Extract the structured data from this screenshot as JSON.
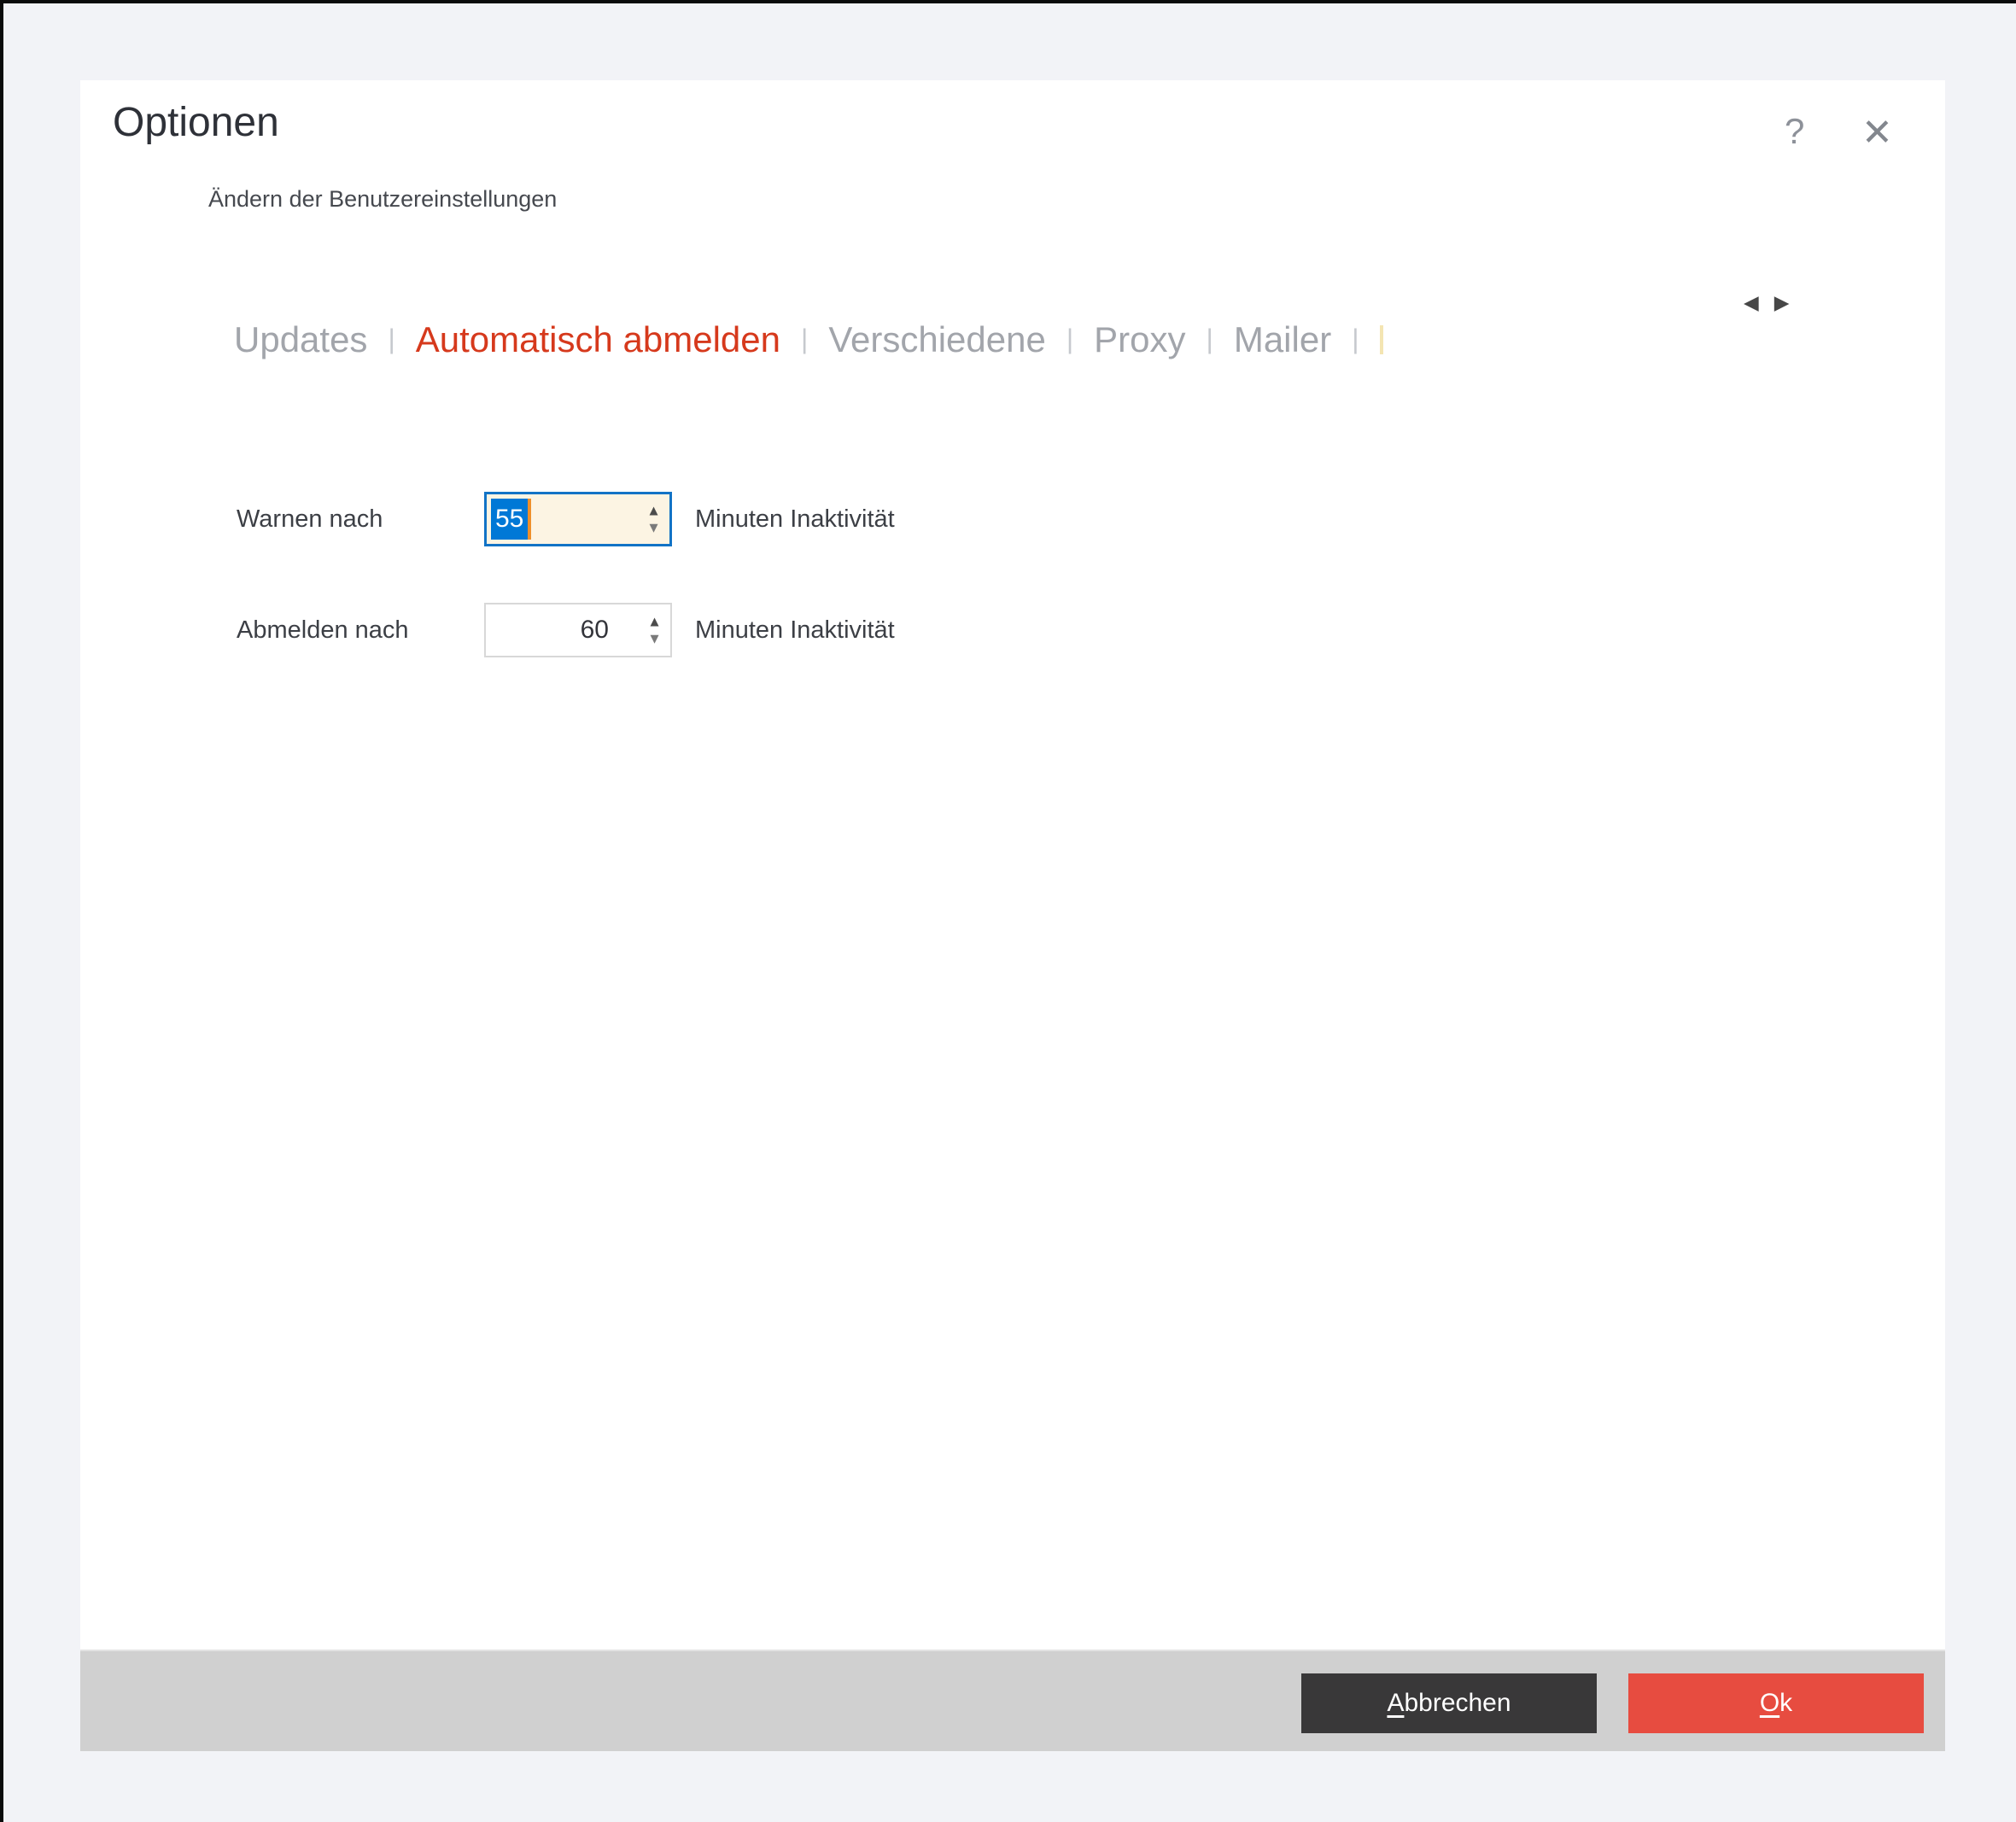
{
  "window": {
    "title": "Optionen",
    "subtitle": "Ändern der Benutzereinstellungen"
  },
  "icons": {
    "help": "?",
    "close": "✕",
    "scroll_left": "◀",
    "scroll_right": "▶",
    "spin_up": "▲",
    "spin_down": "▼"
  },
  "tabs": {
    "separator": "|",
    "items": [
      {
        "label": "Updates",
        "active": false
      },
      {
        "label": "Automatisch abmelden",
        "active": true
      },
      {
        "label": "Verschiedene",
        "active": false
      },
      {
        "label": "Proxy",
        "active": false
      },
      {
        "label": "Mailer",
        "active": false
      }
    ]
  },
  "form": {
    "rows": [
      {
        "label": "Warnen nach",
        "value": "55",
        "suffix": "Minuten Inaktivität",
        "state": "focused, text selected"
      },
      {
        "label": "Abmelden nach",
        "value": "60",
        "suffix": "Minuten Inaktivität",
        "state": "normal"
      }
    ]
  },
  "footer": {
    "cancel": {
      "accesskey": "A",
      "rest": "bbrechen",
      "label": "Abbrechen"
    },
    "ok": {
      "accesskey": "O",
      "rest": "k",
      "label": "Ok"
    }
  },
  "colors": {
    "active_tab_red": "#d6391c",
    "inactive_tab_gray": "#a2a5ab",
    "focus_border_blue": "#1273c6",
    "field_cream": "#fcf4e3",
    "selection_blue": "#0078d6",
    "caret_orange": "#ee8f2a",
    "footer_gray": "#d0d0d0",
    "cancel_button_bg": "#393839",
    "ok_button_bg": "#e74c40",
    "dialog_bg": "#ffffff",
    "desktop_bg": "#f2f3f7"
  }
}
